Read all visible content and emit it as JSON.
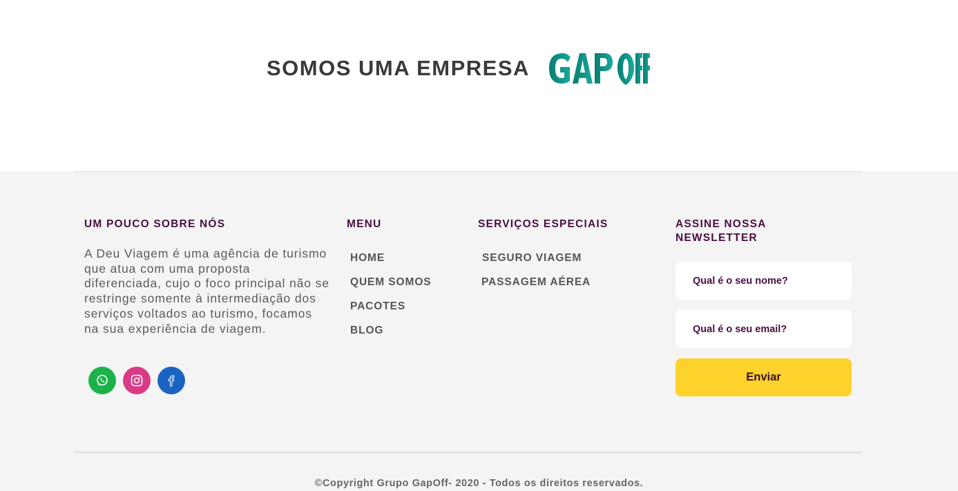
{
  "hero": {
    "tagline": "SOMOS UMA EMPRESA",
    "logo_text": "GAPOFF",
    "logo_colors": [
      "#0a7d72",
      "#12a79a"
    ]
  },
  "about": {
    "title": "UM POUCO SOBRE NÓS",
    "text": "A Deu Viagem é uma agência de turismo que atua com uma proposta diferenciada, cujo o foco principal não se restringe somente à intermediação dos serviços voltados ao turismo, focamos na sua experiência de viagem.",
    "social": [
      {
        "icon": "whatsapp-icon",
        "color": "#1bb24a"
      },
      {
        "icon": "instagram-icon",
        "color": "#d93a86"
      },
      {
        "icon": "facebook-icon",
        "color": "#1b63c2"
      }
    ]
  },
  "menu": {
    "title": "MENU",
    "items": [
      "HOME",
      "QUEM SOMOS",
      "PACOTES",
      "BLOG"
    ]
  },
  "services": {
    "title": "SERVIÇOS ESPECIAIS",
    "items": [
      "SEGURO VIAGEM",
      "PASSAGEM AÉREA"
    ]
  },
  "newsletter": {
    "title_line1": "ASSINE NOSSA",
    "title_line2": "NEWSLETTER",
    "name_placeholder": "Qual é o seu nome?",
    "email_placeholder": "Qual é o seu email?",
    "submit_label": "Enviar",
    "button_color": "#fdd22a"
  },
  "footer": {
    "copyright": "©Copyright Grupo GapOff- 2020 - Todos os direitos reservados."
  }
}
